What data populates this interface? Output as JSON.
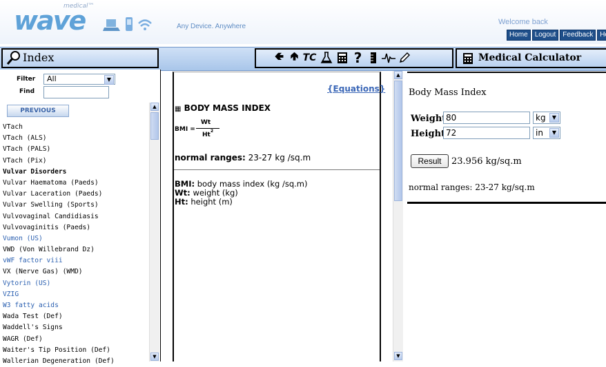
{
  "header": {
    "brand_small": "medical™",
    "brand": "wave",
    "tagline": "Any Device. Anywhere",
    "welcome": "Welcome back",
    "links": [
      "Home",
      "Logout",
      "Feedback",
      "Hel"
    ]
  },
  "index_panel": {
    "title": "Index",
    "filter_label": "Filter",
    "filter_value": "All",
    "find_label": "Find",
    "find_value": "",
    "previous_label": "PREVIOUS",
    "items": [
      {
        "text": "VTach",
        "style": "normal"
      },
      {
        "text": "VTach (ALS)",
        "style": "normal"
      },
      {
        "text": "VTach (PALS)",
        "style": "normal"
      },
      {
        "text": "VTach (Pix)",
        "style": "normal"
      },
      {
        "text": "Vulvar Disorders",
        "style": "bold"
      },
      {
        "text": "Vulvar Haematoma (Paeds)",
        "style": "normal"
      },
      {
        "text": "Vulvar Laceration (Paeds)",
        "style": "normal"
      },
      {
        "text": "Vulvar Swelling (Sports)",
        "style": "normal"
      },
      {
        "text": "Vulvovaginal Candidiasis",
        "style": "normal"
      },
      {
        "text": "Vulvovaginitis (Paeds)",
        "style": "normal"
      },
      {
        "text": "Vumon (US)",
        "style": "blue"
      },
      {
        "text": "VWD (Von Willebrand Dz)",
        "style": "normal"
      },
      {
        "text": "vWF factor viii",
        "style": "blue"
      },
      {
        "text": "VX (Nerve Gas) (WMD)",
        "style": "normal"
      },
      {
        "text": "Vytorin (US)",
        "style": "blue"
      },
      {
        "text": "VZIG",
        "style": "blue"
      },
      {
        "text": "W3 fatty acids",
        "style": "blue"
      },
      {
        "text": "Wada Test (Def)",
        "style": "normal"
      },
      {
        "text": "Waddell's Signs",
        "style": "normal"
      },
      {
        "text": "WAGR (Def)",
        "style": "normal"
      },
      {
        "text": "Waiter's Tip Position (Def)",
        "style": "normal"
      },
      {
        "text": "Wallerian Degeneration (Def)",
        "style": "normal"
      }
    ]
  },
  "toolbar": {
    "icons": [
      "back-arrow-icon",
      "up-arrow-icon",
      "tc-icon",
      "flask-icon",
      "calculator-icon",
      "help-icon",
      "ruler-icon",
      "ecg-icon",
      "pencil-icon"
    ],
    "tc_label": "TC"
  },
  "content": {
    "equations_link": "{Equations}",
    "heading": "BODY MASS INDEX",
    "formula_lhs": "BMI =",
    "formula_num": "Wt",
    "formula_den": "Ht",
    "formula_exp": "2",
    "normal_label": "normal ranges:",
    "normal_value": "23-27 kg /sq.m",
    "defs": [
      {
        "term": "BMI:",
        "desc": "body mass index (kg /sq.m)"
      },
      {
        "term": "Wt:",
        "desc": "weight (kg)"
      },
      {
        "term": "Ht:",
        "desc": "height (m)"
      }
    ]
  },
  "calculator": {
    "title": "Medical Calculator",
    "name": "Body Mass Index",
    "weight_label": "Weight:",
    "weight_value": "80",
    "weight_unit": "kg",
    "height_label": "Height:",
    "height_value": "72",
    "height_unit": "in",
    "result_button": "Result",
    "result_value": "23.956 kg/sq.m",
    "normal_text": "normal ranges: 23-27 kg/sq.m"
  }
}
